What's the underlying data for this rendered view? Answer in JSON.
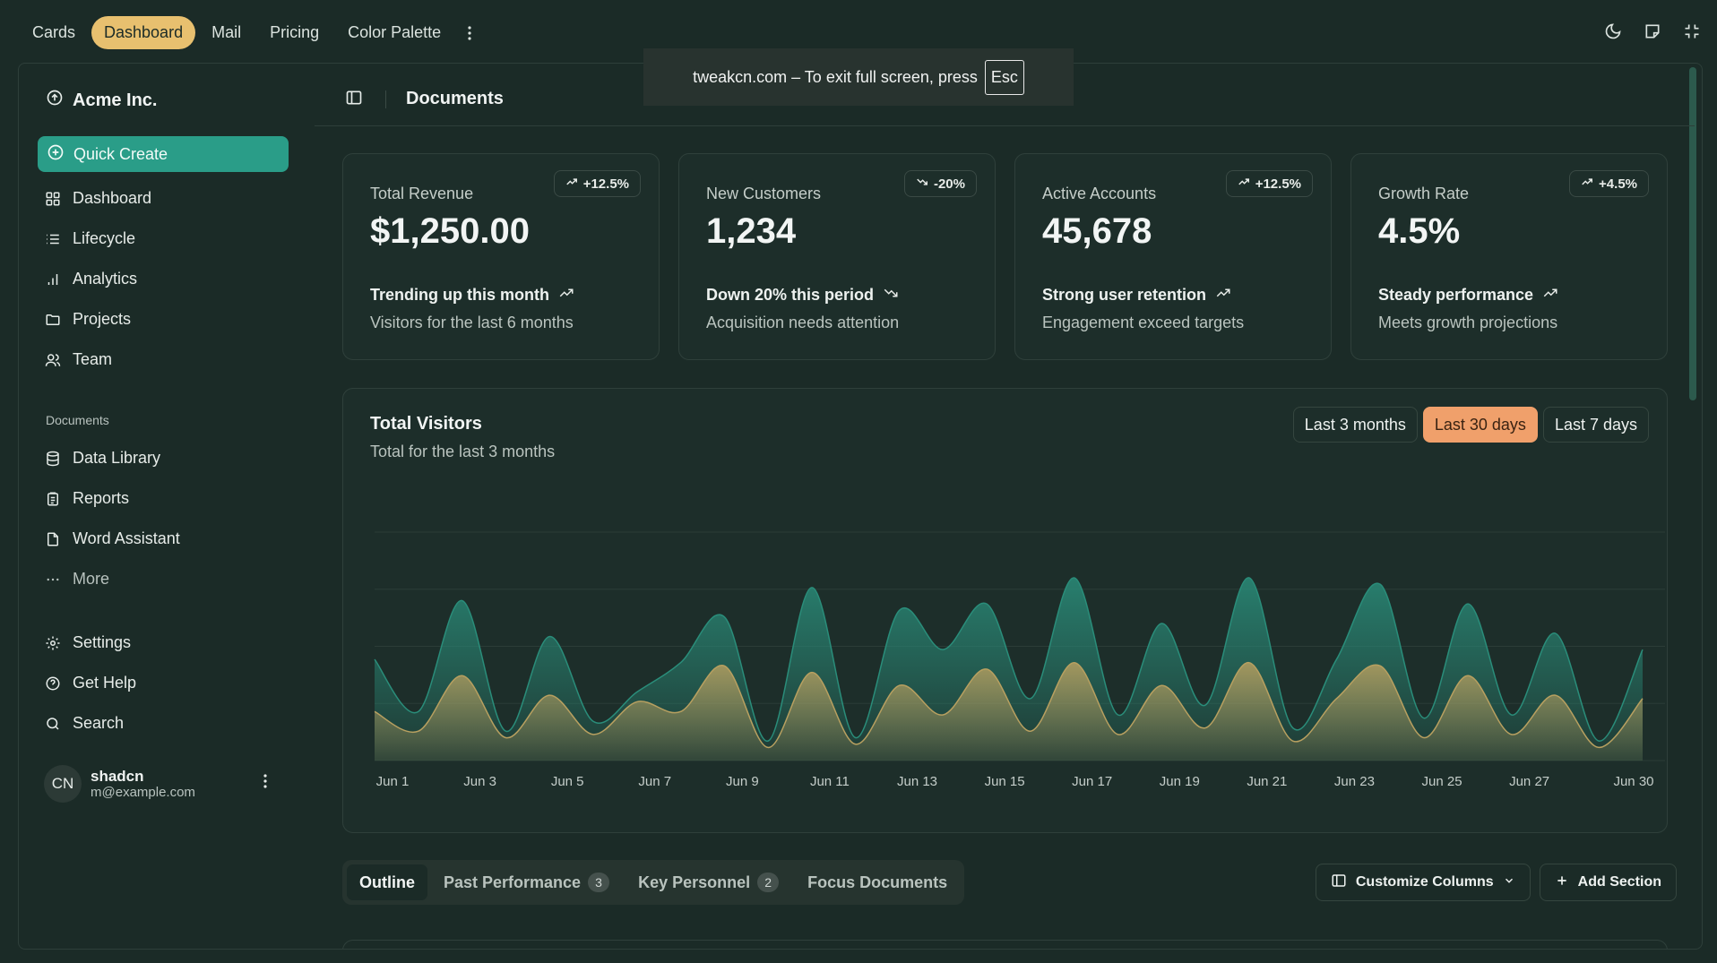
{
  "topnav": {
    "tabs": [
      "Cards",
      "Dashboard",
      "Mail",
      "Pricing",
      "Color Palette"
    ],
    "active_tab": "Dashboard"
  },
  "fullscreen_toast": {
    "text": "tweakcn.com – To exit full screen, press",
    "key": "Esc"
  },
  "sidebar": {
    "brand": "Acme Inc.",
    "quick_create": "Quick Create",
    "items": [
      {
        "label": "Dashboard",
        "icon": "dashboard-icon"
      },
      {
        "label": "Lifecycle",
        "icon": "list-icon"
      },
      {
        "label": "Analytics",
        "icon": "bar-chart-icon"
      },
      {
        "label": "Projects",
        "icon": "folder-icon"
      },
      {
        "label": "Team",
        "icon": "users-icon"
      }
    ],
    "documents_label": "Documents",
    "documents": [
      {
        "label": "Data Library",
        "icon": "database-icon"
      },
      {
        "label": "Reports",
        "icon": "clipboard-icon"
      },
      {
        "label": "Word Assistant",
        "icon": "file-icon"
      },
      {
        "label": "More",
        "icon": "dots-icon"
      }
    ],
    "bottom": [
      {
        "label": "Settings",
        "icon": "gear-icon"
      },
      {
        "label": "Get Help",
        "icon": "help-icon"
      },
      {
        "label": "Search",
        "icon": "search-icon"
      }
    ],
    "user": {
      "initials": "CN",
      "name": "shadcn",
      "email": "m@example.com"
    }
  },
  "header": {
    "title": "Documents"
  },
  "cards": [
    {
      "label": "Total Revenue",
      "value": "$1,250.00",
      "badge": "+12.5%",
      "trend_dir": "up",
      "trend": "Trending up this month",
      "sub": "Visitors for the last 6 months"
    },
    {
      "label": "New Customers",
      "value": "1,234",
      "badge": "-20%",
      "trend_dir": "down",
      "trend": "Down 20% this period",
      "sub": "Acquisition needs attention"
    },
    {
      "label": "Active Accounts",
      "value": "45,678",
      "badge": "+12.5%",
      "trend_dir": "up",
      "trend": "Strong user retention",
      "sub": "Engagement exceed targets"
    },
    {
      "label": "Growth Rate",
      "value": "4.5%",
      "badge": "+4.5%",
      "trend_dir": "up",
      "trend": "Steady performance",
      "sub": "Meets growth projections"
    }
  ],
  "visitors": {
    "title": "Total Visitors",
    "subtitle": "Total for the last 3 months",
    "ranges": [
      "Last 3 months",
      "Last 30 days",
      "Last 7 days"
    ],
    "active_range": "Last 30 days"
  },
  "chart_data": {
    "type": "area",
    "x": [
      "Jun 1",
      "Jun 2",
      "Jun 3",
      "Jun 4",
      "Jun 5",
      "Jun 6",
      "Jun 7",
      "Jun 8",
      "Jun 9",
      "Jun 10",
      "Jun 11",
      "Jun 12",
      "Jun 13",
      "Jun 14",
      "Jun 15",
      "Jun 16",
      "Jun 17",
      "Jun 18",
      "Jun 19",
      "Jun 20",
      "Jun 21",
      "Jun 22",
      "Jun 23",
      "Jun 24",
      "Jun 25",
      "Jun 26",
      "Jun 27",
      "Jun 28",
      "Jun 29",
      "Jun 30"
    ],
    "tick_labels": [
      "Jun 1",
      "Jun 3",
      "Jun 5",
      "Jun 7",
      "Jun 9",
      "Jun 11",
      "Jun 13",
      "Jun 15",
      "Jun 17",
      "Jun 19",
      "Jun 21",
      "Jun 23",
      "Jun 25",
      "Jun 27",
      "Jun 30"
    ],
    "series": [
      {
        "color": "#2a8d7a",
        "values": [
          310,
          150,
          490,
          90,
          380,
          120,
          210,
          300,
          440,
          60,
          530,
          70,
          460,
          340,
          480,
          190,
          560,
          140,
          420,
          170,
          560,
          100,
          310,
          540,
          130,
          480,
          140,
          390,
          60,
          340
        ]
      },
      {
        "color": "#b8a060",
        "values": [
          150,
          90,
          260,
          70,
          200,
          80,
          180,
          150,
          290,
          40,
          270,
          50,
          230,
          140,
          280,
          90,
          300,
          80,
          230,
          100,
          300,
          60,
          190,
          290,
          70,
          260,
          80,
          200,
          40,
          190
        ]
      }
    ],
    "ylim": [
      0,
      700
    ],
    "grid": true,
    "yaxis_visible": false
  },
  "bottom_tabs": [
    {
      "label": "Outline",
      "count": ""
    },
    {
      "label": "Past Performance",
      "count": "3"
    },
    {
      "label": "Key Personnel",
      "count": "2"
    },
    {
      "label": "Focus Documents",
      "count": ""
    }
  ],
  "actions": {
    "customize": "Customize Columns",
    "add": "Add Section"
  }
}
